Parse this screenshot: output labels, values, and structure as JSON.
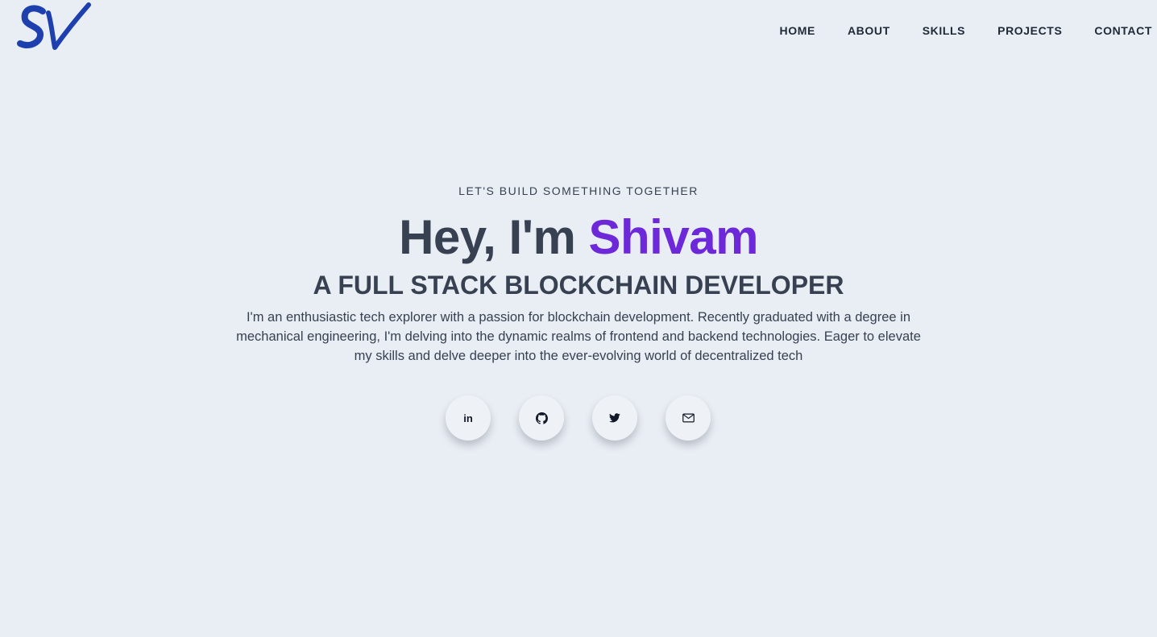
{
  "header": {
    "logo_text": "SV",
    "logo_color": "#1e40af",
    "nav": {
      "items": [
        {
          "label": "HOME"
        },
        {
          "label": "ABOUT"
        },
        {
          "label": "SKILLS"
        },
        {
          "label": "PROJECTS"
        },
        {
          "label": "CONTACT"
        }
      ]
    }
  },
  "hero": {
    "tagline": "LET'S BUILD SOMETHING TOGETHER",
    "greeting": "Hey, I'm ",
    "name": "Shivam",
    "name_color": "#6d28d9",
    "role": "A FULL STACK BLOCKCHAIN DEVELOPER",
    "bio": "I'm an enthusiastic tech explorer with a passion for blockchain development. Recently graduated with a degree in mechanical engineering, I'm delving into the dynamic realms of frontend and backend technologies. Eager to elevate my skills and delve deeper into the ever-evolving world of decentralized tech"
  },
  "socials": {
    "linkedin_icon_text": "in",
    "items": [
      {
        "icon": "linkedin-icon"
      },
      {
        "icon": "github-icon"
      },
      {
        "icon": "twitter-icon"
      },
      {
        "icon": "mail-icon"
      }
    ]
  },
  "colors": {
    "background": "#e9eef4",
    "text": "#374151",
    "accent": "#6d28d9"
  }
}
